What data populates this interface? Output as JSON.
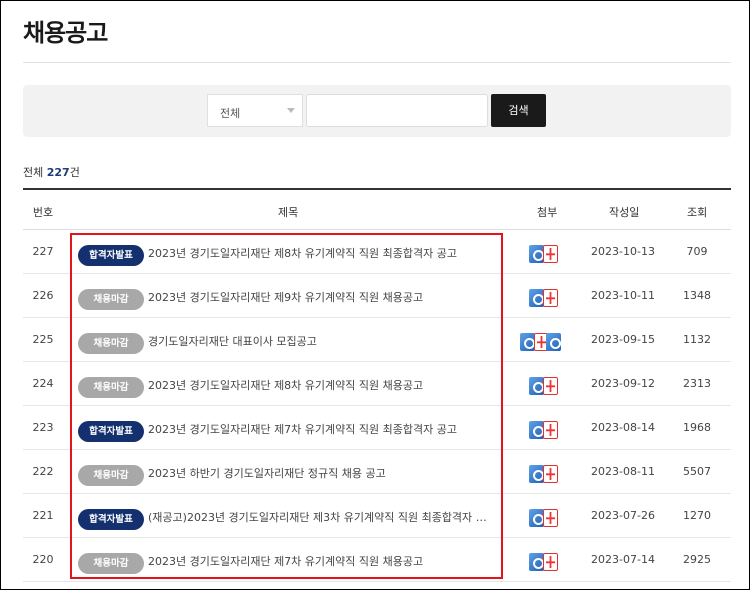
{
  "page": {
    "title": "채용공고"
  },
  "search": {
    "select_value": "전체",
    "input_value": "",
    "button_label": "검색"
  },
  "total": {
    "prefix": "전체",
    "count": "227",
    "suffix": "건"
  },
  "table": {
    "headers": {
      "number": "번호",
      "title": "제목",
      "attachment": "첨부",
      "date": "작성일",
      "views": "조회"
    },
    "rows": [
      {
        "number": "227",
        "badge": "합격자발표",
        "badge_type": "pass",
        "title": "2023년 경기도일자리재단 제8차 유기계약직 직원 최종합격자 공고",
        "files": [
          "hwp-icon",
          "pdf-icon"
        ],
        "date": "2023-10-13",
        "views": "709"
      },
      {
        "number": "226",
        "badge": "채용마감",
        "badge_type": "closed",
        "title": "2023년 경기도일자리재단 제9차 유기계약직 직원 채용공고",
        "files": [
          "hwp-icon",
          "pdf-icon"
        ],
        "date": "2023-10-11",
        "views": "1348"
      },
      {
        "number": "225",
        "badge": "채용마감",
        "badge_type": "closed",
        "title": "경기도일자리재단 대표이사 모집공고",
        "files": [
          "hwp-icon",
          "pdf-icon",
          "hwp-icon"
        ],
        "date": "2023-09-15",
        "views": "1132"
      },
      {
        "number": "224",
        "badge": "채용마감",
        "badge_type": "closed",
        "title": "2023년 경기도일자리재단 제8차 유기계약직 직원 채용공고",
        "files": [
          "hwp-icon",
          "pdf-icon"
        ],
        "date": "2023-09-12",
        "views": "2313"
      },
      {
        "number": "223",
        "badge": "합격자발표",
        "badge_type": "pass",
        "title": "2023년 경기도일자리재단 제7차 유기계약직 직원 최종합격자 공고",
        "files": [
          "hwp-icon",
          "pdf-icon"
        ],
        "date": "2023-08-14",
        "views": "1968"
      },
      {
        "number": "222",
        "badge": "채용마감",
        "badge_type": "closed",
        "title": "2023년 하반기 경기도일자리재단 정규직 채용 공고",
        "files": [
          "hwp-icon",
          "pdf-icon"
        ],
        "date": "2023-08-11",
        "views": "5507"
      },
      {
        "number": "221",
        "badge": "합격자발표",
        "badge_type": "pass",
        "title": "(재공고)2023년 경기도일자리재단 제3차 유기계약직 직원 최종합격자 재…",
        "files": [
          "hwp-icon",
          "pdf-icon"
        ],
        "date": "2023-07-26",
        "views": "1270"
      },
      {
        "number": "220",
        "badge": "채용마감",
        "badge_type": "closed",
        "title": "2023년 경기도일자리재단 제7차 유기계약직 직원 채용공고",
        "files": [
          "hwp-icon",
          "pdf-icon"
        ],
        "date": "2023-07-14",
        "views": "2925"
      }
    ]
  },
  "colors": {
    "pass_badge": "#14306e",
    "closed_badge": "#a8a8a8",
    "highlight_box": "#e3141c",
    "search_button": "#1a1a1a"
  }
}
